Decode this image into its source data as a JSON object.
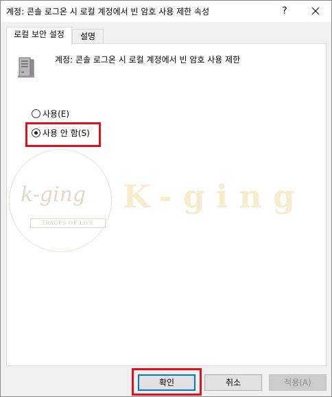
{
  "window": {
    "title": "계정: 콘솔 로그온 시 로컬 계정에서 빈 암호 사용 제한 속성",
    "help_label": "?",
    "close_icon": "close-icon"
  },
  "tabs": [
    {
      "label": "로컬 보안 설정",
      "active": true
    },
    {
      "label": "설명",
      "active": false
    }
  ],
  "policy": {
    "icon": "server-icon",
    "title": "계정: 콘솔 로그온 시 로컬 계정에서 빈 암호 사용 제한"
  },
  "options": [
    {
      "label": "사용(E)",
      "checked": false
    },
    {
      "label": "사용 안 함(S)",
      "checked": true
    }
  ],
  "watermark": {
    "script": "k-ging",
    "tagline": "TRACES OF LIFE",
    "big_text": "K-ging"
  },
  "buttons": {
    "ok": "확인",
    "cancel": "취소",
    "apply": "적용(A)"
  },
  "colors": {
    "highlight": "#e2101a",
    "focus": "#0078d7"
  }
}
